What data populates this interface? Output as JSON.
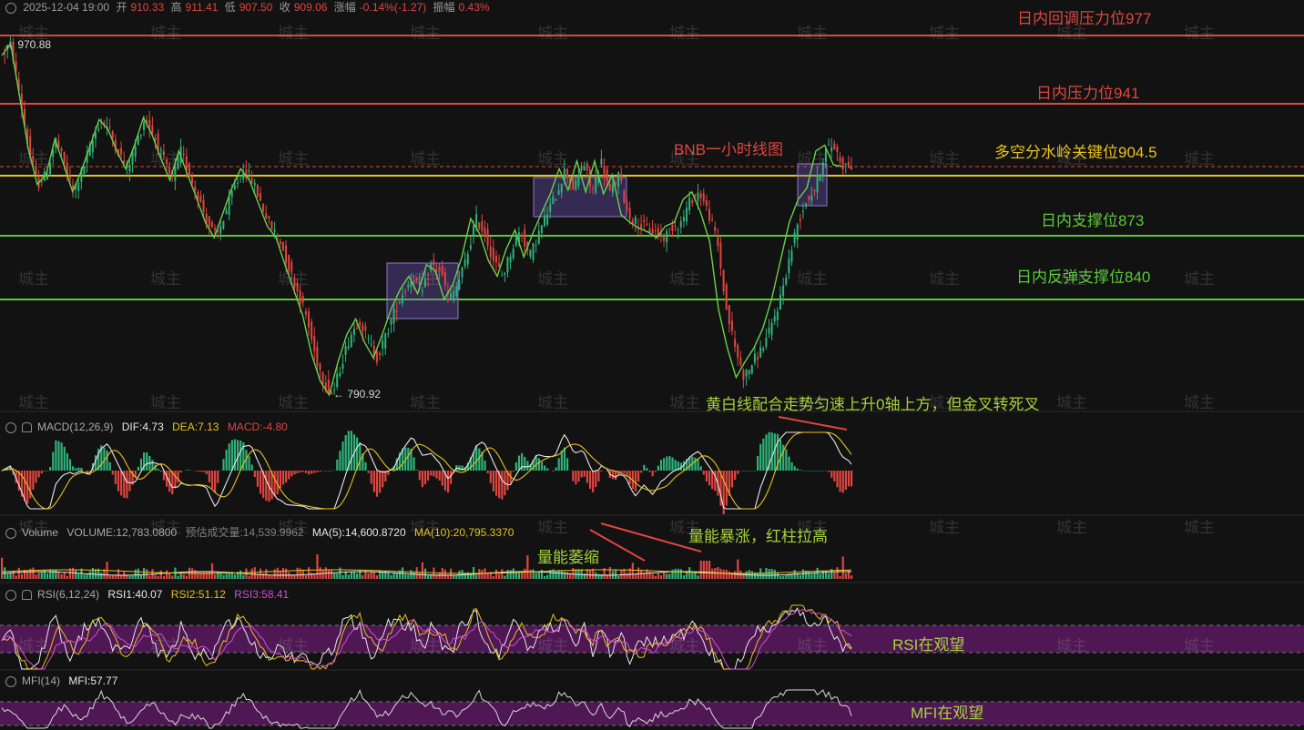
{
  "header": {
    "datetime": "2025-12-04 19:00",
    "open_label": "开",
    "open": "910.33",
    "high_label": "高",
    "high": "911.41",
    "low_label": "低",
    "low": "907.50",
    "close_label": "收",
    "close": "909.06",
    "change_label": "涨幅",
    "change": "-0.14%(-1.27)",
    "amp_label": "振幅",
    "amp": "0.43%"
  },
  "price_panel": {
    "title": "BNB一小时线图",
    "high_marker": "← 970.88",
    "low_marker": "← 790.92",
    "levels": [
      {
        "label": "日内回调压力位977",
        "value": 977,
        "color": "#e0453f"
      },
      {
        "label": "日内压力位941",
        "value": 941,
        "color": "#e0453f"
      },
      {
        "label": "多空分水岭关键位904.5",
        "value": 904.5,
        "color": "#e8c21a"
      },
      {
        "label": "日内支撑位873",
        "value": 873,
        "color": "#5cc93a"
      },
      {
        "label": "日内反弹支撑位840",
        "value": 840,
        "color": "#5cc93a"
      }
    ]
  },
  "macd_panel": {
    "name": "MACD(12,26,9)",
    "dif": "DIF:4.73",
    "dea": "DEA:7.13",
    "macd": "MACD:-4.80",
    "annotation": "黄白线配合走势匀速上升0轴上方，但金叉转死叉"
  },
  "volume_panel": {
    "name": "Volume",
    "volume": "VOLUME:12,783.0800",
    "est": "预估成交量:14,539.9962",
    "ma5": "MA(5):14,600.8720",
    "ma10": "MA(10):20,795.3370",
    "annotation_shrink": "量能萎缩",
    "annotation_surge": "量能暴涨，红柱拉高"
  },
  "rsi_panel": {
    "name": "RSI(6,12,24)",
    "rsi1": "RSI1:40.07",
    "rsi2": "RSI2:51.12",
    "rsi3": "RSI3:58.41",
    "annotation": "RSI在观望"
  },
  "mfi_panel": {
    "name": "MFI(14)",
    "mfi": "MFI:57.77",
    "annotation": "MFI在观望"
  },
  "watermark": "城主",
  "chart_data": {
    "type": "line",
    "title": "BNB一小时线图",
    "ylim": [
      790.92,
      970.88
    ],
    "series": [
      {
        "values": [
          965,
          970.88,
          945,
          918,
          900,
          905,
          923,
          910,
          896,
          907,
          920,
          933,
          928,
          917,
          908,
          920,
          934,
          925,
          913,
          902,
          917,
          905,
          893,
          880,
          872,
          885,
          898,
          908,
          902,
          890,
          878,
          872,
          858,
          845,
          832,
          812,
          798,
          790.92,
          808,
          822,
          830,
          818,
          810,
          822,
          835,
          845,
          852,
          843,
          858,
          855,
          840,
          848,
          862,
          882,
          874,
          860,
          852,
          866,
          876,
          862,
          874,
          885,
          895,
          908,
          897,
          912,
          896,
          912,
          895,
          905,
          884,
          880,
          877,
          875,
          872,
          878,
          880,
          892,
          896,
          885,
          870,
          835,
          815,
          800,
          808,
          815,
          825,
          840,
          860,
          880,
          892,
          898,
          917,
          920,
          910,
          909.06
        ]
      }
    ],
    "boxes": [
      {
        "x_start": 0.455,
        "x_end": 0.54
      },
      {
        "x_start": 0.625,
        "x_end": 0.735
      },
      {
        "x_start": 0.935,
        "x_end": 0.97
      }
    ]
  }
}
